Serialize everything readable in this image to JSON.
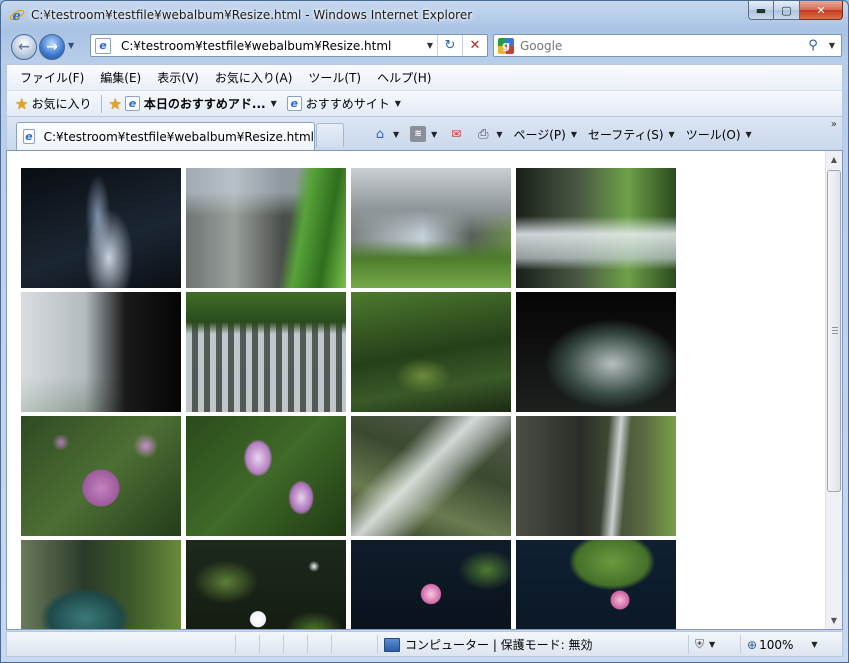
{
  "window": {
    "title": "C:¥testroom¥testfile¥webalbum¥Resize.html - Windows Internet Explorer"
  },
  "address": {
    "url": "C:¥testroom¥testfile¥webalbum¥Resize.html"
  },
  "search": {
    "placeholder": "Google"
  },
  "menu": {
    "items": [
      "ファイル(F)",
      "編集(E)",
      "表示(V)",
      "お気に入り(A)",
      "ツール(T)",
      "ヘルプ(H)"
    ]
  },
  "favorites": {
    "label": "お気に入り",
    "item1": "本日のおすすめアド...",
    "item2": "おすすめサイト"
  },
  "tab": {
    "label": "C:¥testroom¥testfile¥webalbum¥Resize.html"
  },
  "commands": {
    "page": "ページ(P)",
    "safety": "セーフティ(S)",
    "tools": "ツール(O)",
    "more": "»"
  },
  "status": {
    "zone": "コンピューター | 保護モード: 無効",
    "zoom": "100%"
  },
  "gallery": {
    "photos": [
      {
        "name": "photo-waterfall-dark-spray",
        "theme": "dark-spray"
      },
      {
        "name": "photo-waterfall-cliff-green",
        "theme": "cliff-green"
      },
      {
        "name": "photo-waterfall-wide-cliff",
        "theme": "wide-cliff"
      },
      {
        "name": "photo-waterfall-cascade-green",
        "theme": "cascade-green"
      },
      {
        "name": "photo-waterfall-cave-left",
        "theme": "cave-left"
      },
      {
        "name": "photo-waterfall-curtain",
        "theme": "curtain"
      },
      {
        "name": "photo-forest-rock",
        "theme": "forest-rock"
      },
      {
        "name": "photo-waterfall-cave-arch",
        "theme": "cave-arch"
      },
      {
        "name": "photo-hydrangea-pink",
        "theme": "hydrangea"
      },
      {
        "name": "photo-iris-flowers",
        "theme": "iris"
      },
      {
        "name": "photo-stream-rocks",
        "theme": "stream-rocks"
      },
      {
        "name": "photo-waterfall-gorge",
        "theme": "gorge"
      },
      {
        "name": "photo-pool-mossy",
        "theme": "pool-mossy"
      },
      {
        "name": "photo-white-waterlily",
        "theme": "white-lily"
      },
      {
        "name": "photo-pink-waterlily",
        "theme": "pink-lily"
      },
      {
        "name": "photo-pink-waterlily-pad",
        "theme": "pink-lily-pad"
      }
    ]
  },
  "colors": {
    "frame": "#a9c3e4",
    "close_button": "#c4391c",
    "link_blue": "#2a6bc8"
  }
}
